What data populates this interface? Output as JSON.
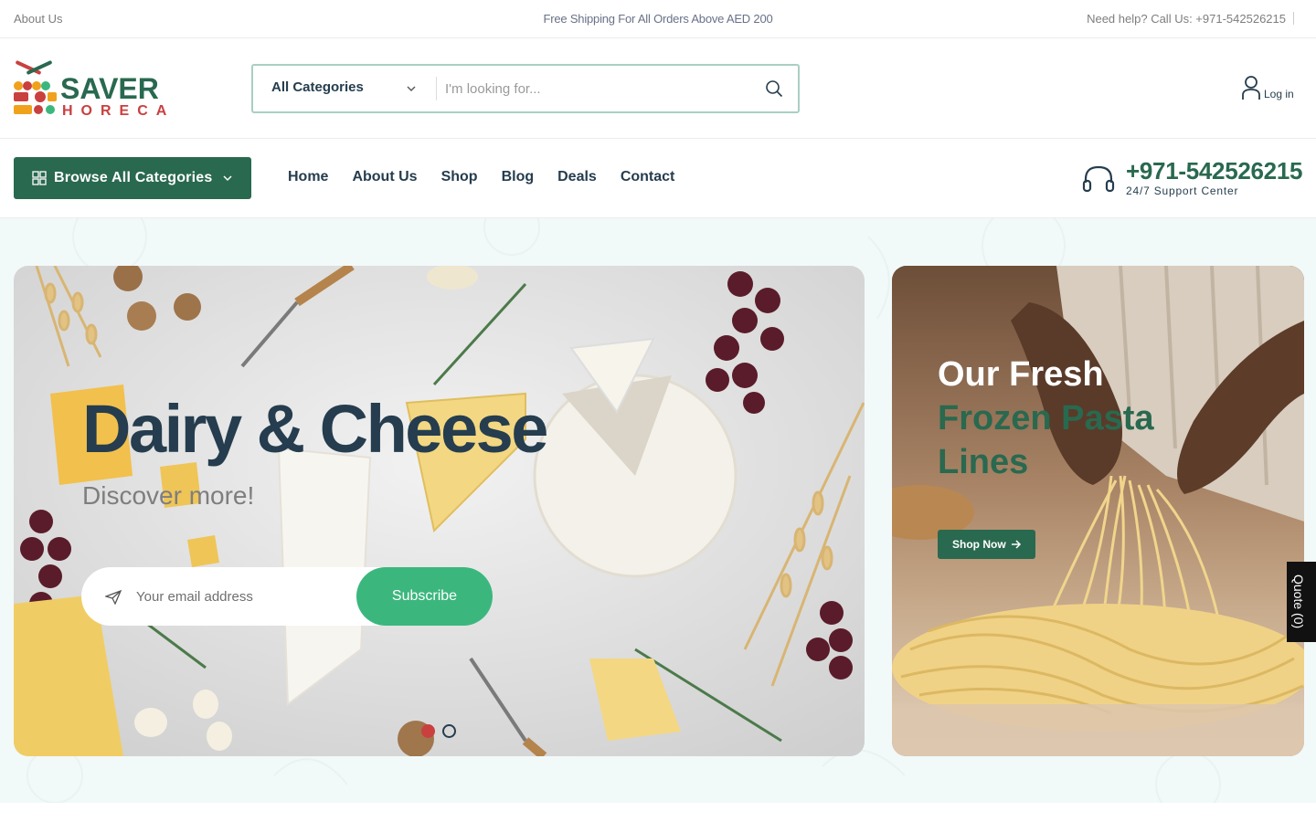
{
  "topbar": {
    "about": "About Us",
    "shipping": "Free Shipping For All Orders Above AED 200",
    "help": "Need help? Call Us: +971-542526215"
  },
  "header": {
    "logo_line1": "SAVER",
    "logo_line2": "HORECA",
    "search": {
      "category": "All Categories",
      "placeholder": "I'm looking for..."
    },
    "login": "Log in"
  },
  "nav": {
    "browse": "Browse All Categories",
    "items": [
      "Home",
      "About Us",
      "Shop",
      "Blog",
      "Deals",
      "Contact"
    ],
    "support_phone": "+971-542526215",
    "support_label": "24/7 Support Center"
  },
  "hero": {
    "title": "Dairy & Cheese",
    "subtitle": "Discover more!",
    "email_placeholder": "Your email address",
    "subscribe": "Subscribe",
    "active_slide": 1,
    "slide_count": 2
  },
  "promo": {
    "line1": "Our Fresh",
    "line2": "Frozen Pasta",
    "line3": "Lines",
    "button": "Shop Now"
  },
  "quote": "Quote (0)",
  "colors": {
    "brand_green": "#29694f",
    "accent_green": "#3bb77e",
    "heading": "#253d4e",
    "active_dot": "#c9403f"
  }
}
